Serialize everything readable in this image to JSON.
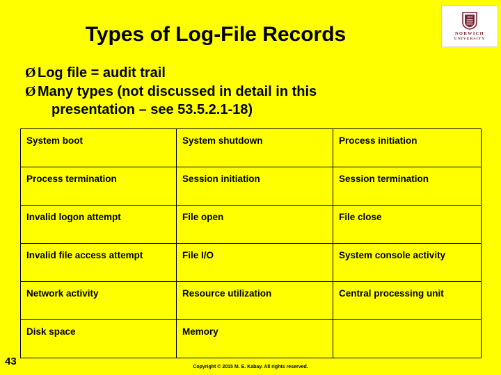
{
  "slide": {
    "title": "Types of Log-File Records",
    "bullets": [
      {
        "marker": "Ø",
        "line1": "Log file = audit trail",
        "line2": ""
      },
      {
        "marker": "Ø",
        "line1": "Many types (not discussed in detail in this",
        "line2": "presentation – see 53.5.2.1-18)"
      }
    ],
    "table": {
      "rows": [
        [
          "System boot",
          "System shutdown",
          "Process initiation"
        ],
        [
          "Process termination",
          "Session initiation",
          "Session termination"
        ],
        [
          "Invalid logon attempt",
          "File open",
          "File close"
        ],
        [
          "Invalid file access attempt",
          "File I/O",
          "System console activity"
        ],
        [
          "Network activity",
          "Resource utilization",
          "Central processing unit"
        ],
        [
          "Disk space",
          "Memory",
          ""
        ]
      ]
    },
    "slide_number": "43",
    "copyright": "Copyright © 2015 M. E. Kabay.  All rights reserved.",
    "logo": {
      "year": "1819",
      "name": "NORWICH",
      "subtitle": "UNIVERSITY"
    },
    "colors": {
      "background": "#ffff00",
      "text": "#000000",
      "logo_maroon": "#7a2230"
    }
  }
}
